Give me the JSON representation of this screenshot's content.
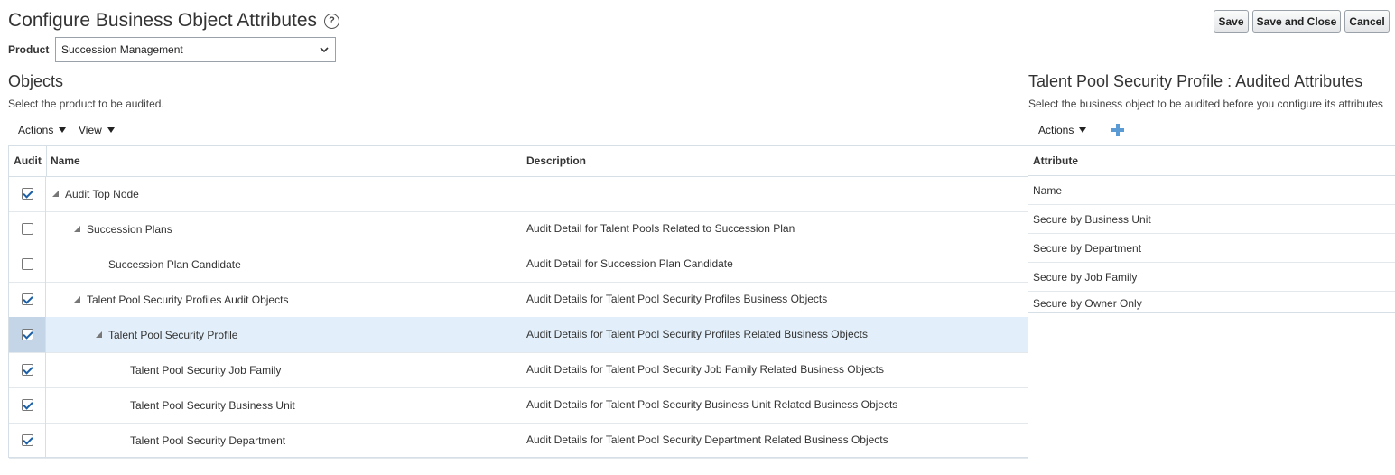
{
  "header": {
    "title": "Configure Business Object Attributes",
    "help_glyph": "?",
    "save_label": "Save",
    "save_close_label": "Save and Close",
    "cancel_label": "Cancel"
  },
  "product": {
    "label": "Product",
    "selected": "Succession Management"
  },
  "objects": {
    "title": "Objects",
    "subtitle": "Select the product to be audited.",
    "toolbar": {
      "actions": "Actions",
      "view": "View"
    },
    "columns": {
      "audit": "Audit",
      "name": "Name",
      "description": "Description"
    },
    "rows": [
      {
        "name": "Audit Top Node",
        "description": "",
        "checked": true,
        "level": 0,
        "expandable": true
      },
      {
        "name": "Succession Plans",
        "description": "Audit Detail for Talent Pools Related to Succession Plan",
        "checked": false,
        "level": 1,
        "expandable": true
      },
      {
        "name": "Succession Plan Candidate",
        "description": "Audit Detail for Succession Plan Candidate",
        "checked": false,
        "level": 2,
        "expandable": false
      },
      {
        "name": "Talent Pool Security Profiles Audit Objects",
        "description": "Audit Details for Talent Pool Security Profiles Business Objects",
        "checked": true,
        "level": 1,
        "expandable": true
      },
      {
        "name": "Talent Pool Security Profile",
        "description": "Audit Details for Talent Pool Security Profiles Related Business Objects",
        "checked": true,
        "level": 2,
        "expandable": true,
        "selected": true
      },
      {
        "name": "Talent Pool Security Job Family",
        "description": "Audit Details for Talent Pool Security Job Family Related Business Objects",
        "checked": true,
        "level": 3,
        "expandable": false
      },
      {
        "name": "Talent Pool Security Business Unit",
        "description": "Audit Details for Talent Pool Security Business Unit Related Business Objects",
        "checked": true,
        "level": 3,
        "expandable": false
      },
      {
        "name": "Talent Pool Security Department",
        "description": "Audit Details for Talent Pool Security Department Related Business Objects",
        "checked": true,
        "level": 3,
        "expandable": false
      }
    ]
  },
  "attributes": {
    "title": "Talent Pool Security Profile : Audited Attributes",
    "subtitle": "Select the business object to be audited before you configure its attributes",
    "toolbar": {
      "actions": "Actions",
      "add_icon": "plus-icon"
    },
    "column": "Attribute",
    "rows": [
      "Name",
      "Secure by Business Unit",
      "Secure by Department",
      "Secure by Job Family",
      "Secure by Owner Only"
    ]
  },
  "colors": {
    "accent": "#5b9bd5",
    "selected_row": "#e2effa",
    "border": "#d6dfe6"
  }
}
